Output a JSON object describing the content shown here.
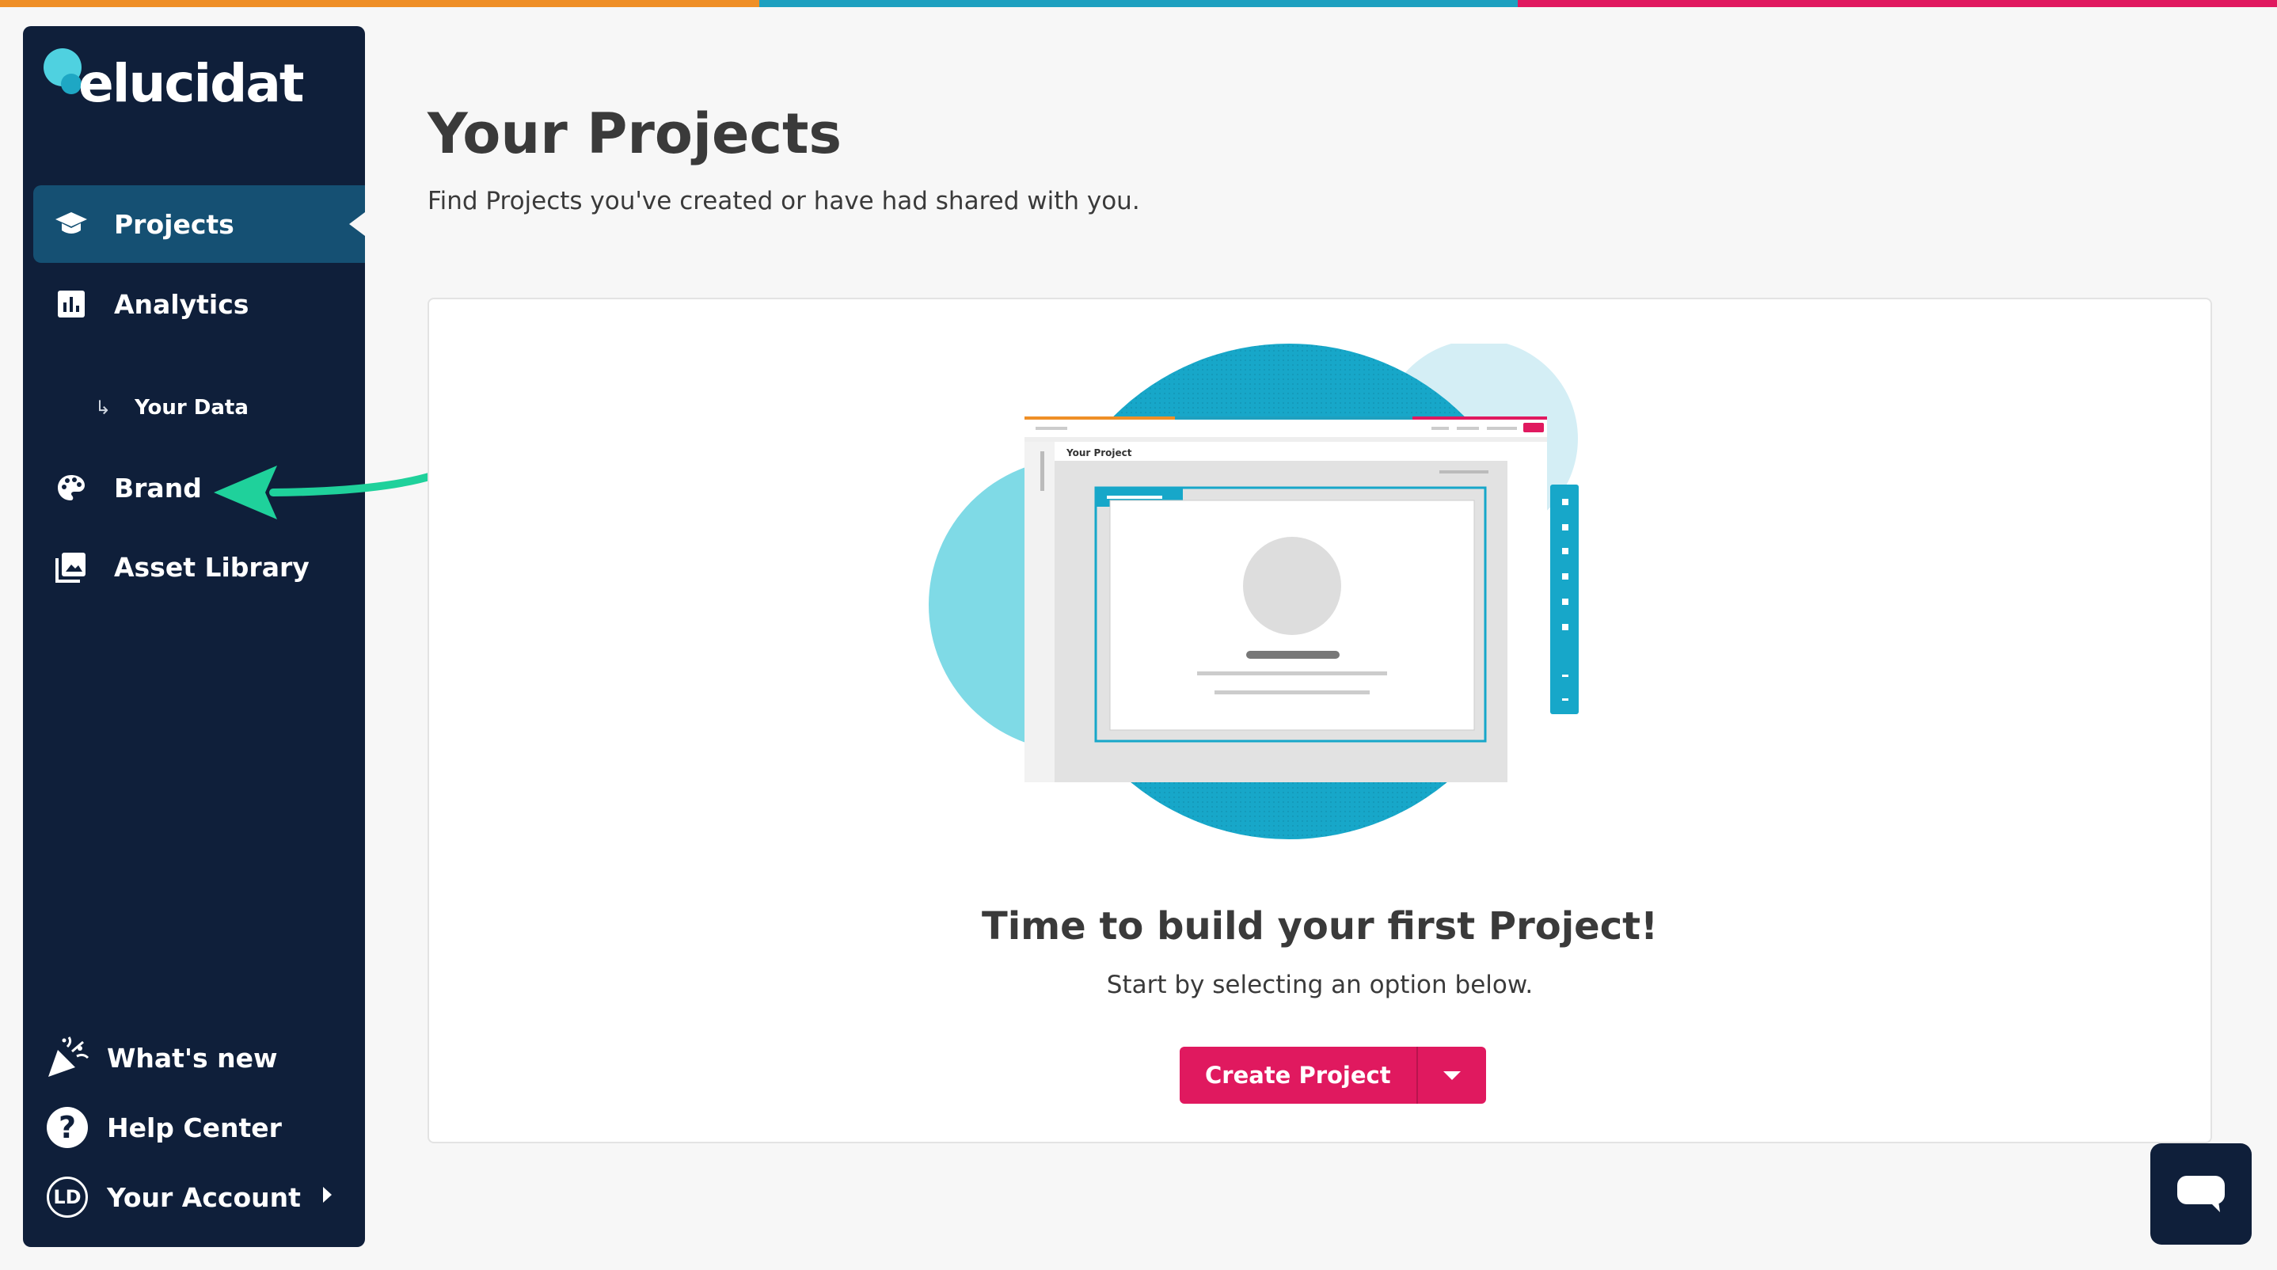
{
  "brand": {
    "name": "elucidat"
  },
  "colors": {
    "top_bar": [
      "#ef8f27",
      "#1ea0c0",
      "#e0195f"
    ],
    "sidebar_bg": "#0f1f3a",
    "active_bg": "#155073",
    "accent": "#e0195f",
    "annotation_arrow": "#1fd19b"
  },
  "sidebar": {
    "items": [
      {
        "label": "Projects",
        "icon": "graduation-cap-icon",
        "active": true
      },
      {
        "label": "Analytics",
        "icon": "bar-chart-icon"
      },
      {
        "label": "Your Data",
        "icon": "sub-arrow-icon"
      },
      {
        "label": "Brand",
        "icon": "palette-icon"
      },
      {
        "label": "Asset Library",
        "icon": "image-gallery-icon"
      }
    ],
    "bottom": [
      {
        "label": "What's new",
        "icon": "party-popper-icon"
      },
      {
        "label": "Help Center",
        "icon": "question-circle-icon"
      },
      {
        "label": "Your Account",
        "icon": "avatar",
        "initials": "LD"
      }
    ]
  },
  "main": {
    "title": "Your Projects",
    "subtitle": "Find Projects you've created or have had shared with you.",
    "empty_state": {
      "illustration_label": "Your Project",
      "title": "Time to build your first Project!",
      "subtitle": "Start by selecting an option below.",
      "button": "Create Project"
    }
  }
}
